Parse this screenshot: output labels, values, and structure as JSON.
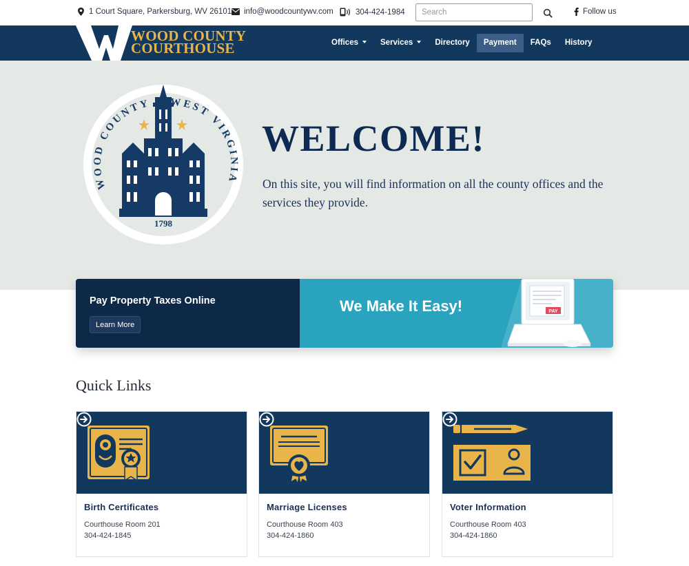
{
  "topbar": {
    "address": "1 Court Square, Parkersburg, WV 26101",
    "email": "info@woodcountywv.com",
    "phone": "304-424-1984",
    "search_placeholder": "Search",
    "follow_label": "Follow us"
  },
  "header": {
    "logo_line1": "WOOD COUNTY",
    "logo_line2": "COURTHOUSE"
  },
  "nav": {
    "items": [
      {
        "label": "Offices",
        "dropdown": true
      },
      {
        "label": "Services",
        "dropdown": true
      },
      {
        "label": "Directory",
        "dropdown": false
      },
      {
        "label": "Payment",
        "dropdown": false,
        "active": true
      },
      {
        "label": "FAQs",
        "dropdown": false
      },
      {
        "label": "History",
        "dropdown": false
      }
    ]
  },
  "hero": {
    "seal": {
      "top_text": "WOOD COUNTY",
      "right_text": "WEST VIRGINIA",
      "year": "1798"
    },
    "title": "WELCOME!",
    "text": "On this site, you will find information on all the county offices and the services they provide."
  },
  "banner": {
    "title": "Pay Property Taxes Online",
    "button_label": "Learn More",
    "slogan": "We Make It Easy!",
    "laptop_label": "PAY"
  },
  "quick_links": {
    "title": "Quick Links",
    "cards": [
      {
        "title": "Birth Certificates",
        "location": "Courthouse Room 201",
        "phone": "304-424-1845",
        "icon": "birth-certificate-icon"
      },
      {
        "title": "Marriage Licenses",
        "location": "Courthouse Room 403",
        "phone": "304-424-1860",
        "icon": "marriage-license-icon"
      },
      {
        "title": "Voter Information",
        "location": "Courthouse Room 403",
        "phone": "304-424-1860",
        "icon": "voter-information-icon"
      }
    ]
  },
  "colors": {
    "navy": "#13385d",
    "gold": "#e9b44a",
    "teal": "#2aa3bf",
    "hero_bg": "#e4e9e5"
  }
}
